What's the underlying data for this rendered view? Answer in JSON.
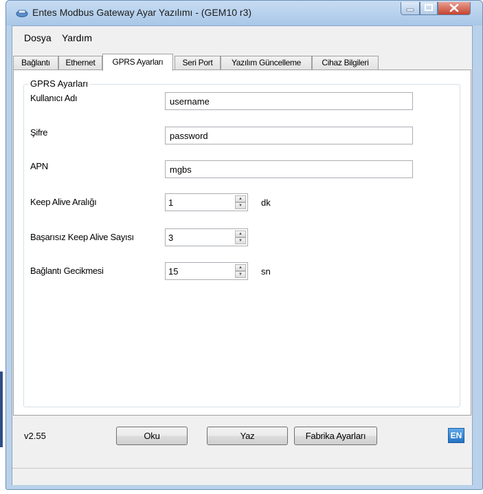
{
  "window": {
    "title": "Entes Modbus Gateway Ayar Yazılımı - (GEM10 r3)"
  },
  "menu": [
    "Dosya",
    "Yardım"
  ],
  "tabs": [
    "Bağlantı",
    "Ethernet",
    "GPRS Ayarları",
    "Seri Port",
    "Yazılım Güncelleme",
    "Cihaz Bilgileri"
  ],
  "active_tab": "GPRS Ayarları",
  "group": {
    "title": "GPRS Ayarları",
    "username": {
      "label": "Kullanıcı Adı",
      "value": "username"
    },
    "password": {
      "label": "Şifre",
      "value": "password"
    },
    "apn": {
      "label": "APN",
      "value": "mgbs"
    },
    "keep_alive_interval": {
      "label": "Keep Alive Aralığı",
      "value": "1",
      "unit": "dk"
    },
    "failed_keep_alive": {
      "label": "Başarısız Keep Alive Sayısı",
      "value": "3"
    },
    "connection_delay": {
      "label": "Bağlantı Gecikmesi",
      "value": "15",
      "unit": "sn"
    }
  },
  "footer": {
    "version": "v2.55",
    "read_label": "Oku",
    "write_label": "Yaz",
    "factory_label": "Fabrika Ayarları",
    "lang_label": "EN"
  },
  "colors": {
    "accent": "#2473c3",
    "title_bar": "#b9d1ea",
    "close": "#c7432e"
  }
}
